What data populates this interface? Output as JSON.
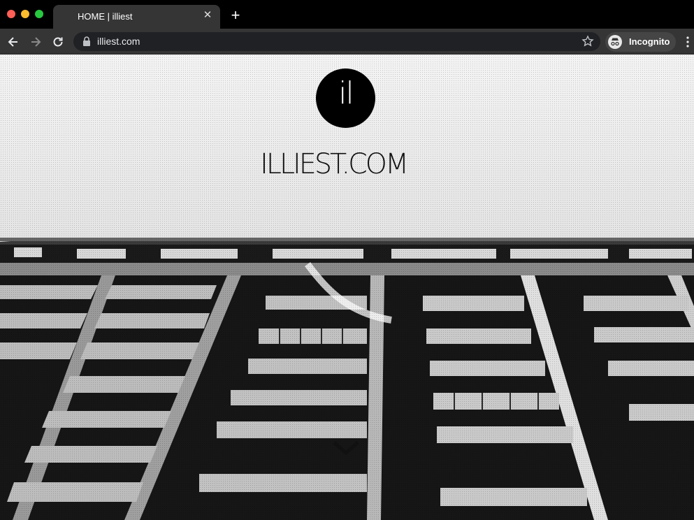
{
  "browser": {
    "tab_title": "HOME | illiest",
    "tab_close_icon": "close-icon",
    "new_tab_icon": "plus-icon",
    "url": "illiest.com",
    "profile_label": "Incognito"
  },
  "page": {
    "logo_text": "il",
    "site_title": "ILLIEST.COM",
    "scroll_icon": "chevron-down-icon"
  },
  "colors": {
    "chrome_dark": "#000000",
    "toolbar": "#353535",
    "omnibox": "#202124"
  }
}
